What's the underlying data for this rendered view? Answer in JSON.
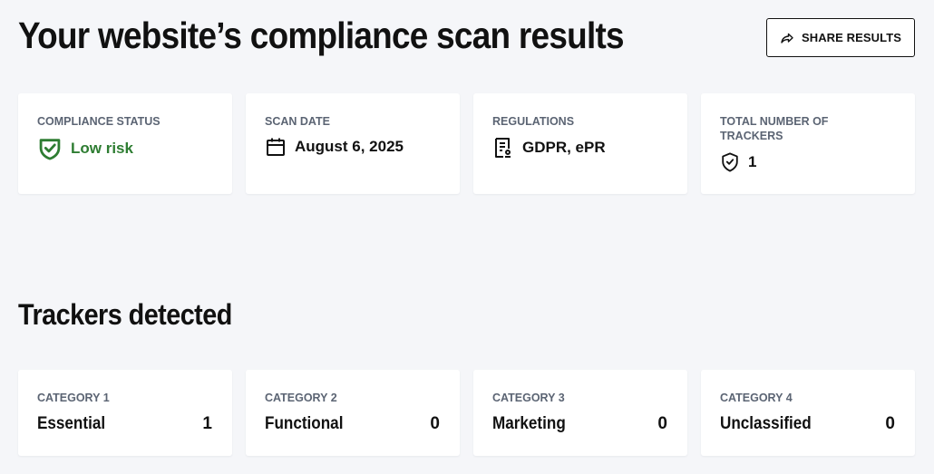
{
  "header": {
    "title": "Your website’s compliance scan results",
    "share_label": "SHARE RESULTS"
  },
  "summary": {
    "compliance": {
      "label": "COMPLIANCE STATUS",
      "value": "Low risk",
      "icon": "shield-check-icon",
      "color": "#2e7d32"
    },
    "scan_date": {
      "label": "SCAN DATE",
      "value": "August 6, 2025",
      "icon": "calendar-icon"
    },
    "regulations": {
      "label": "REGULATIONS",
      "value": "GDPR, ePR",
      "icon": "document-icon"
    },
    "trackers": {
      "label": "TOTAL NUMBER OF TRACKERS",
      "value": "1",
      "icon": "shield-outline-icon"
    }
  },
  "trackers_section": {
    "title": "Trackers detected",
    "categories": [
      {
        "label": "CATEGORY 1",
        "name": "Essential",
        "count": "1"
      },
      {
        "label": "CATEGORY 2",
        "name": "Functional",
        "count": "0"
      },
      {
        "label": "CATEGORY 3",
        "name": "Marketing",
        "count": "0"
      },
      {
        "label": "CATEGORY 4",
        "name": "Unclassified",
        "count": "0"
      }
    ]
  }
}
